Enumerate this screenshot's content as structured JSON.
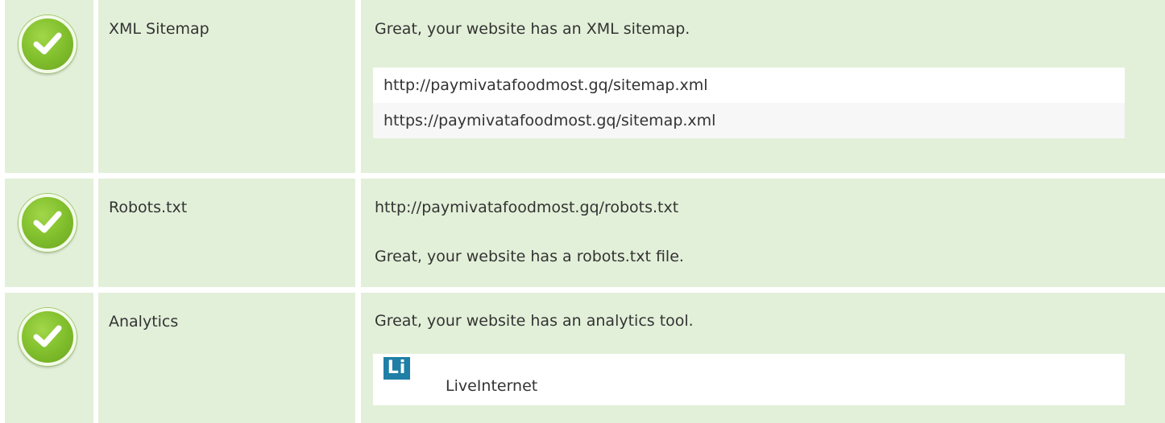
{
  "rows": [
    {
      "label": "XML Sitemap",
      "message": "Great, your website has an XML sitemap.",
      "items": [
        "http://paymivatafoodmost.gq/sitemap.xml",
        "https://paymivatafoodmost.gq/sitemap.xml"
      ]
    },
    {
      "label": "Robots.txt",
      "url": "http://paymivatafoodmost.gq/robots.txt",
      "message": "Great, your website has a robots.txt file."
    },
    {
      "label": "Analytics",
      "message": "Great, your website has an analytics tool.",
      "tool": {
        "logo_text": "Li",
        "name": "LiveInternet"
      }
    }
  ],
  "icons": {
    "status": "check-circle-icon",
    "status_color": "#84c22f"
  },
  "colors": {
    "row_background": "#e3f0d9",
    "text": "#333333",
    "logo_background": "#1f7fa6"
  }
}
